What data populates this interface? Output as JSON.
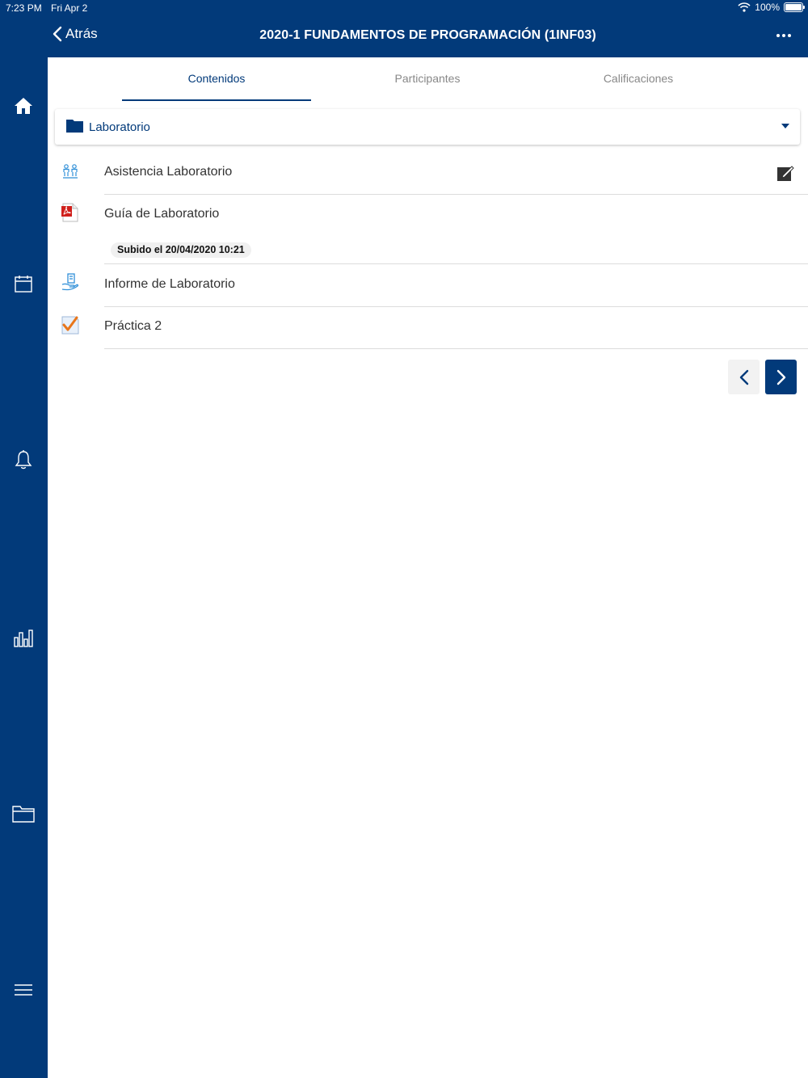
{
  "status_bar": {
    "time": "7:23 PM",
    "date": "Fri Apr 2",
    "battery": "100%"
  },
  "nav": {
    "back_label": "Atrás",
    "title": "2020-1 FUNDAMENTOS DE PROGRAMACIÓN (1INF03)"
  },
  "tabs": [
    {
      "label": "Contenidos",
      "active": true
    },
    {
      "label": "Participantes",
      "active": false
    },
    {
      "label": "Calificaciones",
      "active": false
    }
  ],
  "folder": {
    "label": "Laboratorio"
  },
  "items": [
    {
      "label": "Asistencia Laboratorio",
      "icon": "attendance-icon"
    },
    {
      "label": "Guía de Laboratorio",
      "icon": "pdf-file-icon",
      "badge": "Subido el 20/04/2020 10:21"
    },
    {
      "label": "Informe de Laboratorio",
      "icon": "assignment-submit-icon"
    },
    {
      "label": "Práctica 2",
      "icon": "quiz-check-icon"
    }
  ],
  "sidebar_icons": [
    "home-icon",
    "calendar-icon",
    "bell-icon",
    "bar-chart-icon",
    "folder-outline-icon",
    "menu-icon"
  ],
  "colors": {
    "brand": "#023A7A",
    "pdf_red": "#D0201C",
    "check_orange": "#E8761B"
  }
}
